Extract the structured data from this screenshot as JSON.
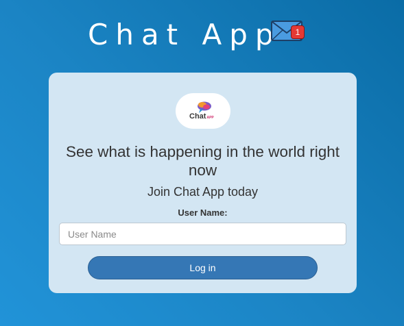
{
  "header": {
    "title": "Chat App",
    "mail_icon": "envelope-icon",
    "notification_count": "1"
  },
  "card": {
    "logo": {
      "icon": "chat-bubble-logo-icon",
      "word": "Chat",
      "sub": "APP"
    },
    "headline": "See what is happening in the world right now",
    "subheadline": "Join Chat App today",
    "field_label": "User Name:",
    "username_placeholder": "User Name",
    "username_value": "",
    "login_label": "Log in"
  },
  "colors": {
    "background_top": "#0a6ca6",
    "background_bottom": "#2193d8",
    "card_background": "#d3e6f3",
    "button": "#3577b5",
    "badge": "#e53935"
  }
}
